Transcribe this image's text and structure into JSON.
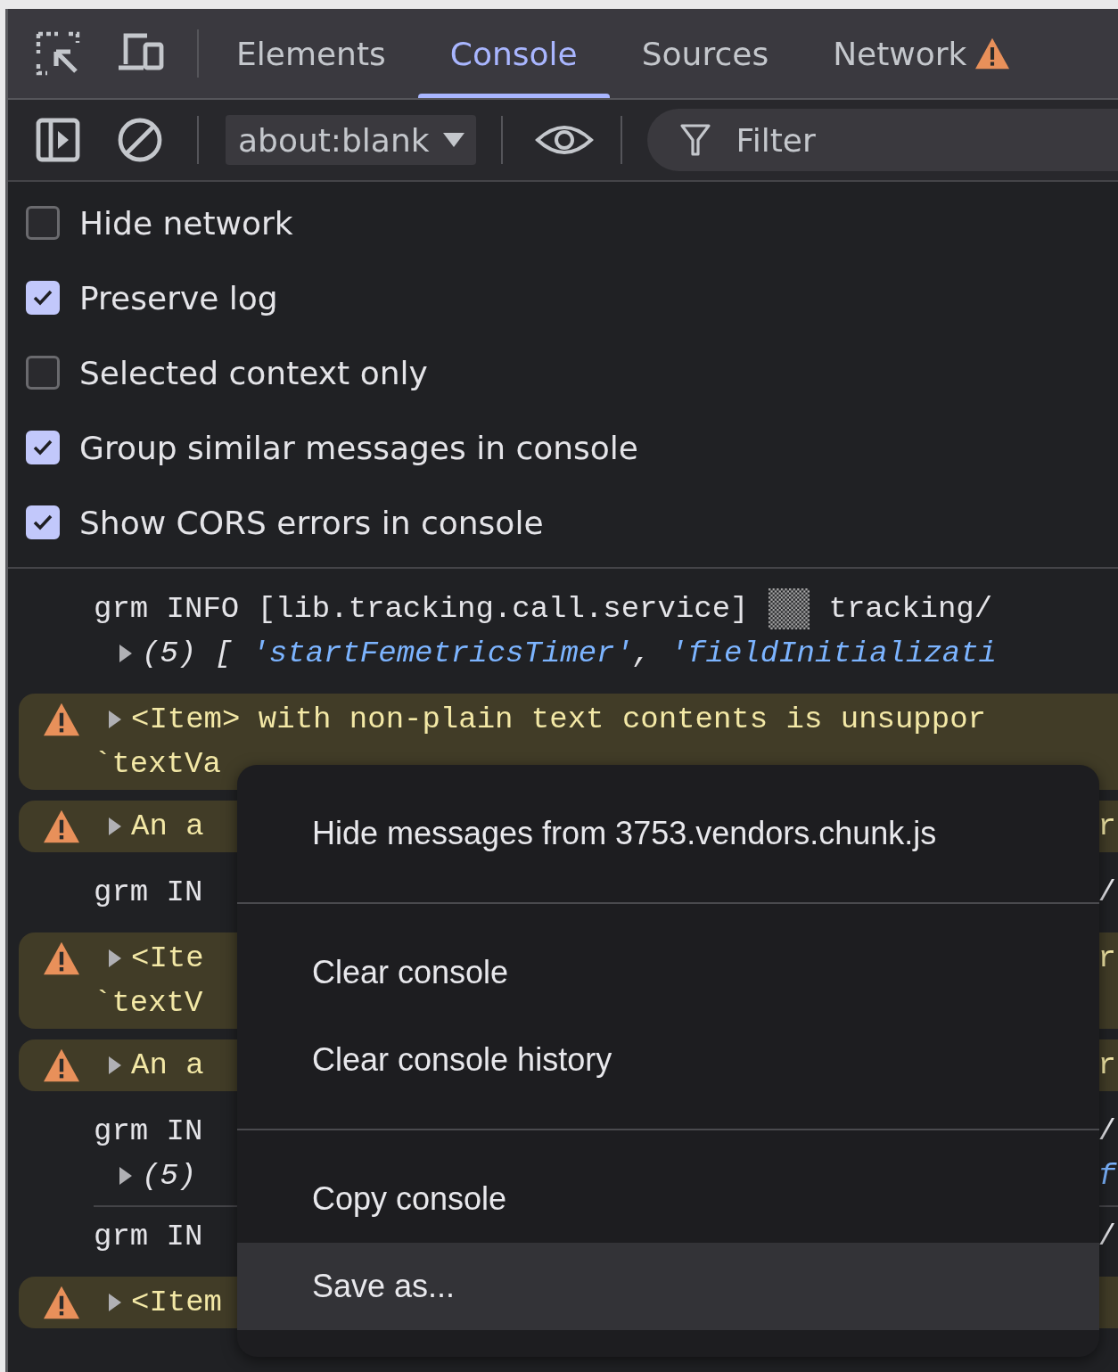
{
  "tabs": [
    {
      "label": "Elements",
      "selected": false,
      "warning": false
    },
    {
      "label": "Console",
      "selected": true,
      "warning": false
    },
    {
      "label": "Sources",
      "selected": false,
      "warning": false
    },
    {
      "label": "Network",
      "selected": false,
      "warning": true
    }
  ],
  "toolbar": {
    "context": "about:blank",
    "filter": {
      "placeholder": "Filter"
    }
  },
  "settings": [
    {
      "label": "Hide network",
      "checked": false
    },
    {
      "label": "Preserve log",
      "checked": true
    },
    {
      "label": "Selected context only",
      "checked": false
    },
    {
      "label": "Group similar messages in console",
      "checked": true
    },
    {
      "label": "Show CORS errors in console",
      "checked": true
    }
  ],
  "messages": [
    {
      "kind": "info",
      "lines": [
        {
          "segments": [
            {
              "kind": "text",
              "text": "grm INFO [lib.tracking.call.service]"
            },
            {
              "kind": "badge"
            },
            {
              "kind": "text",
              "text": "tracking/"
            }
          ]
        },
        {
          "expanded": false,
          "segments": [
            {
              "kind": "count",
              "text": "(5)"
            },
            {
              "kind": "punct",
              "text": "["
            },
            {
              "kind": "string",
              "text": "'startFemetricsTimer'"
            },
            {
              "kind": "punct",
              "text": ","
            },
            {
              "kind": "string",
              "text": "'fieldInitializati"
            }
          ]
        }
      ]
    },
    {
      "kind": "warn",
      "lines": [
        {
          "expanded": false,
          "segments": [
            {
              "kind": "text",
              "text": "<Item> with non-plain text contents is unsuppor"
            }
          ]
        },
        {
          "segments": [
            {
              "kind": "text",
              "text": "`textVa"
            }
          ]
        }
      ]
    },
    {
      "kind": "warn",
      "lines": [
        {
          "expanded": false,
          "segments": [
            {
              "kind": "text",
              "text": "An a"
            }
          ],
          "tail": {
            "kind": "text",
            "text": "r"
          }
        }
      ]
    },
    {
      "kind": "info",
      "lines": [
        {
          "segments": [
            {
              "kind": "text",
              "text": "grm IN"
            }
          ],
          "tail": {
            "kind": "text",
            "text": "/"
          }
        }
      ]
    },
    {
      "kind": "warn",
      "lines": [
        {
          "expanded": false,
          "segments": [
            {
              "kind": "text",
              "text": "<Ite"
            }
          ],
          "tail": {
            "kind": "text",
            "text": "r"
          }
        },
        {
          "segments": [
            {
              "kind": "text",
              "text": "`textV"
            }
          ]
        }
      ]
    },
    {
      "kind": "warn",
      "lines": [
        {
          "expanded": false,
          "segments": [
            {
              "kind": "text",
              "text": "An a"
            }
          ],
          "tail": {
            "kind": "text",
            "text": "r"
          }
        }
      ]
    },
    {
      "kind": "info",
      "lines": [
        {
          "segments": [
            {
              "kind": "text",
              "text": "grm IN"
            }
          ],
          "tail": {
            "kind": "text",
            "text": "/"
          }
        },
        {
          "expanded": false,
          "segments": [
            {
              "kind": "count",
              "text": "(5)"
            }
          ],
          "tail": {
            "kind": "string",
            "text": "f"
          }
        }
      ]
    },
    {
      "kind": "info",
      "lines": [
        {
          "segments": [
            {
              "kind": "text",
              "text": "grm IN"
            }
          ],
          "tail": {
            "kind": "text",
            "text": "/"
          }
        }
      ]
    },
    {
      "kind": "warn",
      "lines": [
        {
          "expanded": false,
          "segments": [
            {
              "kind": "text",
              "text": "<Item"
            }
          ]
        }
      ]
    }
  ],
  "context_menu": [
    {
      "kind": "item",
      "label": "Hide messages from 3753.vendors.chunk.js",
      "selected": false
    },
    {
      "kind": "separator"
    },
    {
      "kind": "item",
      "label": "Clear console",
      "selected": false
    },
    {
      "kind": "item",
      "label": "Clear console history",
      "selected": false
    },
    {
      "kind": "separator"
    },
    {
      "kind": "item",
      "label": "Copy console",
      "selected": false
    },
    {
      "kind": "item",
      "label": "Save as...",
      "selected": true
    }
  ]
}
